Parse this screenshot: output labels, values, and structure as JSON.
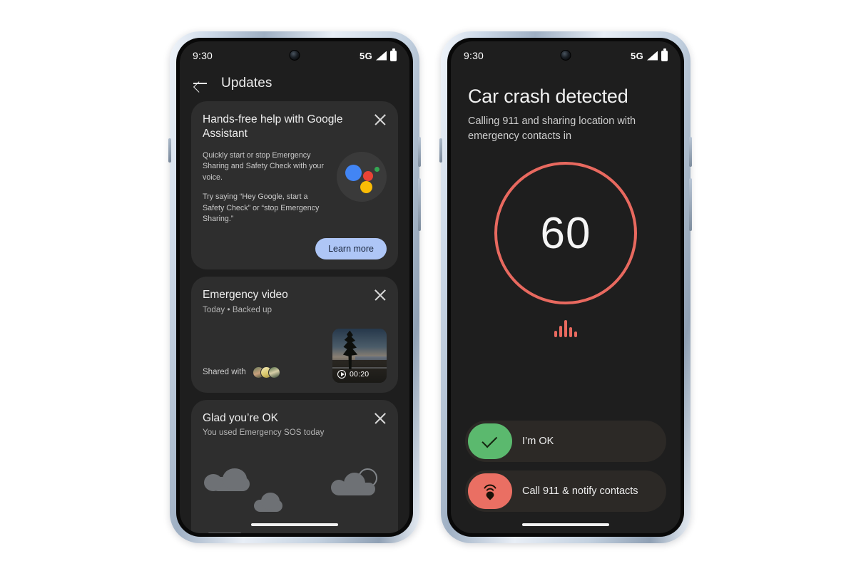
{
  "theme": {
    "page_bg": "#ffffff",
    "screen_bg": "#1e1e1e",
    "card_bg": "#2e2e2e",
    "accent_red": "#e8695f",
    "accent_green": "#5bb96e",
    "accent_blue_button": "#aec6f6"
  },
  "left_phone": {
    "status_bar": {
      "time": "9:30",
      "network": "5G",
      "signal_icon": "signal-bars-icon",
      "battery_icon": "battery-icon"
    },
    "app_bar": {
      "back_icon": "back-arrow-icon",
      "title": "Updates"
    },
    "cards": [
      {
        "id": "assistant",
        "title": "Hands-free help with Google Assistant",
        "close_icon": "close-icon",
        "paragraphs": [
          "Quickly start or stop Emergency Sharing and Safety Check with your voice.",
          "Try saying “Hey Google, start a Safety Check” or “stop Emergency Sharing.”"
        ],
        "orb_icon": "google-assistant-icon",
        "button_label": "Learn more"
      },
      {
        "id": "emergency-video",
        "title": "Emergency video",
        "subtitle": "Today • Backed up",
        "close_icon": "close-icon",
        "shared_label": "Shared with",
        "avatar_count": 3,
        "thumbnail": {
          "play_icon": "play-circle-icon",
          "duration": "00:20"
        }
      },
      {
        "id": "glad-youre-ok",
        "title": "Glad you’re OK",
        "subtitle": "You used Emergency SOS today",
        "close_icon": "close-icon",
        "illustration": "clouds-sun-camping-illustration"
      }
    ],
    "gesture_bar": "home-gesture-bar"
  },
  "right_phone": {
    "status_bar": {
      "time": "9:30",
      "network": "5G",
      "signal_icon": "signal-bars-icon",
      "battery_icon": "battery-icon"
    },
    "title": "Car crash detected",
    "subtitle": "Calling 911 and sharing location with emergency contacts in",
    "countdown": "60",
    "waveform_icon": "audio-waveform-icon",
    "actions": [
      {
        "id": "im-ok",
        "icon": "check-icon",
        "label": "I’m OK",
        "color": "#5bb96e"
      },
      {
        "id": "call-911",
        "icon": "location-pin-signal-icon",
        "label": "Call 911 & notify contacts",
        "color": "#ea6f63"
      }
    ],
    "gesture_bar": "home-gesture-bar"
  }
}
